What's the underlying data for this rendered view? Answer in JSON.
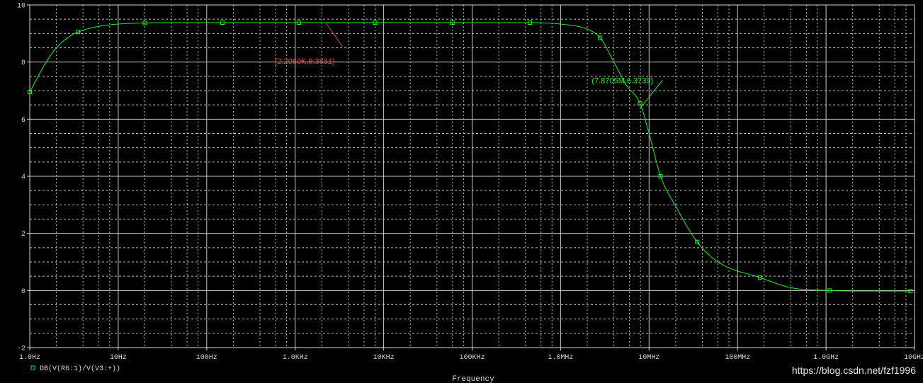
{
  "chart_data": {
    "type": "line",
    "xlabel": "Frequency",
    "xscale": "log",
    "xlim": [
      1,
      10000000000
    ],
    "ylim": [
      -2,
      10
    ],
    "grid": true,
    "x_ticks": [
      "1.0Hz",
      "10Hz",
      "100Hz",
      "1.0KHz",
      "10KHz",
      "100KHz",
      "1.0MHz",
      "10MHz",
      "100MHz",
      "1.0GHz",
      "10GHz"
    ],
    "y_ticks": [
      "10",
      "8",
      "6",
      "4",
      "2",
      "0",
      "-2"
    ],
    "series": [
      {
        "name": "DB(V(R6:1)/V(V3:+))",
        "color": "#22ee22",
        "x": [
          1,
          1.5,
          2,
          3,
          3.5,
          5,
          7,
          10,
          20,
          50,
          100,
          150,
          1000,
          8000,
          60000,
          450000,
          1000000,
          2000000,
          2800000,
          4000000,
          5500000,
          7900000,
          10000000,
          13500000,
          20000000,
          35000000,
          60000000,
          180000000,
          400000000,
          1100000000,
          3000000000,
          9000000000
        ],
        "y": [
          6.95,
          7.95,
          8.5,
          8.95,
          9.05,
          9.2,
          9.28,
          9.33,
          9.37,
          9.38,
          9.38,
          9.38,
          9.38,
          9.38,
          9.38,
          9.38,
          9.33,
          9.15,
          8.85,
          8.0,
          7.2,
          6.55,
          5.5,
          4.0,
          2.95,
          1.7,
          1.0,
          0.45,
          0.1,
          0.0,
          -0.02,
          -0.02
        ]
      }
    ],
    "markers_x": [
      1,
      3.5,
      20,
      150,
      1100,
      8000,
      60000,
      450000,
      2800000,
      7900000,
      13500000,
      35000000,
      180000000,
      1100000000,
      9000000000
    ],
    "annotations": [
      {
        "text": "(2.2080K,9.3831)",
        "color": "#ee4444",
        "x": 2208,
        "y": 9.3831
      },
      {
        "text": "(7.8705M,6.3739)",
        "color": "#22ee22",
        "x": 7870500,
        "y": 6.3739
      }
    ]
  },
  "legend": {
    "label": "DB(V(R6:1)/V(V3:+))"
  },
  "watermark": "https://blog.csdn.net/fzf1996"
}
